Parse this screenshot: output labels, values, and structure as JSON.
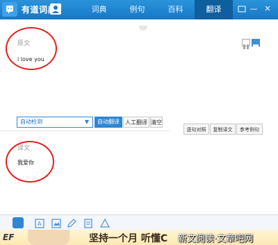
{
  "app": {
    "title": "有道词典"
  },
  "nav": {
    "tabs": [
      {
        "label": "词典"
      },
      {
        "label": "例句"
      },
      {
        "label": "百科"
      },
      {
        "label": "翻译"
      }
    ],
    "active": "翻译"
  },
  "source": {
    "label": "原文",
    "text": "i love you"
  },
  "toolbar": {
    "lang_select": "自动检测",
    "lang_arrow": "▼",
    "auto_translate": "自动翻译",
    "manual_translate": "人工翻译",
    "clear": "清空",
    "side_buttons": [
      {
        "label": "逐句对照"
      },
      {
        "label": "复制译文"
      },
      {
        "label": "参考例句"
      }
    ]
  },
  "result": {
    "label": "译文",
    "text": "我爱你"
  },
  "banner": {
    "brand": "EF",
    "text": "坚持一个月 听懂C",
    "watermark": "新文阅读·文章吧网"
  },
  "colors": {
    "titlebar": "#1778c6",
    "accent": "#2f86d3",
    "annotation": "#e41f1f"
  },
  "icons": [
    "logo-icon",
    "user-icon",
    "minimize-icon",
    "restore-icon",
    "close-icon",
    "window-list-icon",
    "window-split-icon",
    "text-icon",
    "image-icon",
    "edit-icon",
    "note-icon",
    "tree-icon"
  ]
}
